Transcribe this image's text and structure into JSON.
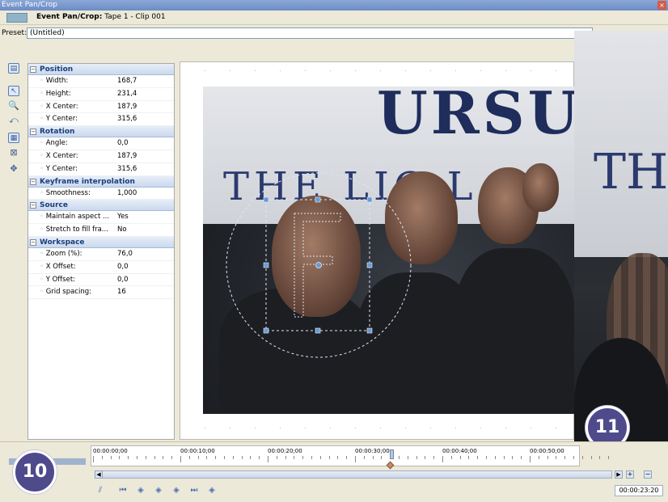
{
  "window": {
    "title": "Event Pan/Crop",
    "close_glyph": "×"
  },
  "header": {
    "title_bold": "Event Pan/Crop:",
    "title_rest": " Tape 1 - Clip 001"
  },
  "preset": {
    "label": "Preset:",
    "value": "(Untitled)"
  },
  "tools": [
    {
      "name": "show-properties-icon",
      "glyph": "▤"
    },
    {
      "name": "normal-edit-tool-icon",
      "glyph": "↖"
    },
    {
      "name": "zoom-tool-icon",
      "glyph": "🔍"
    },
    {
      "name": "enable-rotation-icon",
      "glyph": "⤺"
    },
    {
      "name": "snap-to-grid-icon",
      "glyph": "▦"
    },
    {
      "name": "lock-aspect-ratio-icon",
      "glyph": "⊠"
    },
    {
      "name": "move-freely-icon",
      "glyph": "✥"
    }
  ],
  "properties": {
    "position": {
      "title": "Position",
      "rows": [
        {
          "name": "Width:",
          "value": "168,7"
        },
        {
          "name": "Height:",
          "value": "231,4"
        },
        {
          "name": "X Center:",
          "value": "187,9"
        },
        {
          "name": "Y Center:",
          "value": "315,6"
        }
      ]
    },
    "rotation": {
      "title": "Rotation",
      "rows": [
        {
          "name": "Angle:",
          "value": "0,0"
        },
        {
          "name": "X Center:",
          "value": "187,9"
        },
        {
          "name": "Y Center:",
          "value": "315,6"
        }
      ]
    },
    "keyframe": {
      "title": "Keyframe interpolation",
      "rows": [
        {
          "name": "Smoothness:",
          "value": "1,000"
        }
      ]
    },
    "source": {
      "title": "Source",
      "rows": [
        {
          "name": "Maintain aspect ...",
          "value": "Yes"
        },
        {
          "name": "Stretch to fill fra...",
          "value": "No"
        }
      ]
    },
    "workspace": {
      "title": "Workspace",
      "rows": [
        {
          "name": "Zoom (%):",
          "value": "76,0"
        },
        {
          "name": "X Offset:",
          "value": "0,0"
        },
        {
          "name": "Y Offset:",
          "value": "0,0"
        },
        {
          "name": "Grid spacing:",
          "value": "16"
        }
      ]
    }
  },
  "preview": {
    "banner_big": "URSU",
    "banner_small": "THE  LIG  L",
    "frame_letter": "F",
    "zoom_letter": "TH"
  },
  "badges": {
    "left": "10",
    "right": "11"
  },
  "timeline": {
    "ticks": [
      "00:00:00;00",
      "00:00:10;00",
      "00:00:20;00",
      "00:00:30;00",
      "00:00:40;00",
      "00:00:50;00"
    ],
    "timecode": "00:00:23:20",
    "scroll_left": "◀",
    "scroll_right": "▶",
    "zoom_in": "+",
    "zoom_out": "−",
    "buttons": [
      {
        "name": "sync-cursor-icon",
        "glyph": "⫽"
      },
      {
        "name": "first-keyframe-icon",
        "glyph": "⏮"
      },
      {
        "name": "previous-keyframe-icon",
        "glyph": "◈"
      },
      {
        "name": "add-keyframe-icon",
        "glyph": "◈"
      },
      {
        "name": "next-keyframe-icon",
        "glyph": "◈"
      },
      {
        "name": "last-keyframe-icon",
        "glyph": "⏭"
      },
      {
        "name": "delete-keyframe-icon",
        "glyph": "◈"
      },
      {
        "name": "keyframe-icon",
        "glyph": "◇"
      }
    ]
  }
}
